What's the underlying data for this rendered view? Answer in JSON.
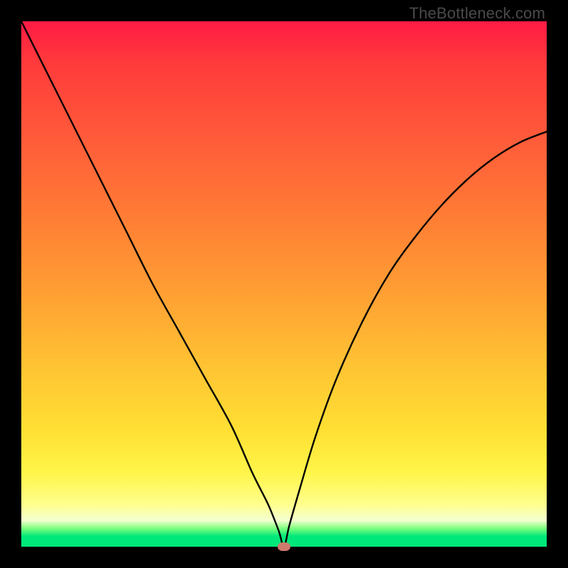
{
  "watermark": "TheBottleneck.com",
  "chart_data": {
    "type": "line",
    "title": "",
    "xlabel": "",
    "ylabel": "",
    "xlim": [
      0,
      100
    ],
    "ylim": [
      0,
      100
    ],
    "background_gradient": {
      "top": "#ff1a45",
      "mid_upper": "#ff7a35",
      "mid": "#ffe033",
      "mid_lower": "#ffff8e",
      "bottom": "#00e87a"
    },
    "series": [
      {
        "name": "bottleneck-curve",
        "x": [
          0,
          5,
          10,
          15,
          20,
          25,
          30,
          35,
          40,
          44,
          47,
          49,
          50,
          51,
          53,
          56,
          60,
          65,
          70,
          75,
          80,
          85,
          90,
          95,
          100
        ],
        "values": [
          100,
          90,
          80,
          70,
          60,
          50,
          41,
          32,
          23,
          14,
          8,
          3,
          0,
          4,
          11,
          21,
          32,
          43,
          52,
          59,
          65,
          70,
          74,
          77,
          79
        ]
      }
    ],
    "marker": {
      "x": 50,
      "y": 0,
      "color": "#cf7a6d"
    }
  }
}
